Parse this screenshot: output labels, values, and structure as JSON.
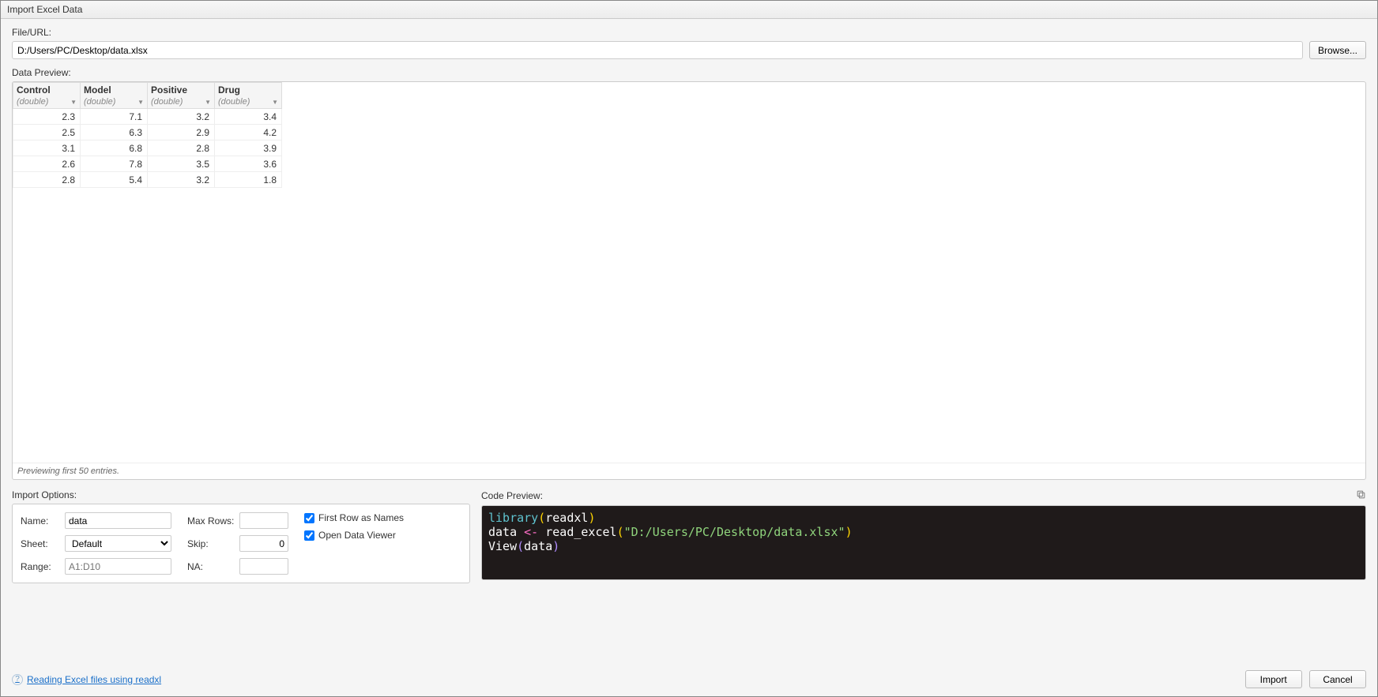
{
  "window_title": "Import Excel Data",
  "file_url_label": "File/URL:",
  "file_path": "D:/Users/PC/Desktop/data.xlsx",
  "browse_label": "Browse...",
  "data_preview_label": "Data Preview:",
  "columns": [
    {
      "name": "Control",
      "type": "(double)"
    },
    {
      "name": "Model",
      "type": "(double)"
    },
    {
      "name": "Positive",
      "type": "(double)"
    },
    {
      "name": "Drug",
      "type": "(double)"
    }
  ],
  "rows": [
    [
      "2.3",
      "7.1",
      "3.2",
      "3.4"
    ],
    [
      "2.5",
      "6.3",
      "2.9",
      "4.2"
    ],
    [
      "3.1",
      "6.8",
      "2.8",
      "3.9"
    ],
    [
      "2.6",
      "7.8",
      "3.5",
      "3.6"
    ],
    [
      "2.8",
      "5.4",
      "3.2",
      "1.8"
    ]
  ],
  "preview_status": "Previewing first 50 entries.",
  "import_options_label": "Import Options:",
  "options": {
    "name_label": "Name:",
    "name_value": "data",
    "sheet_label": "Sheet:",
    "sheet_value": "Default",
    "range_label": "Range:",
    "range_placeholder": "A1:D10",
    "maxrows_label": "Max Rows:",
    "maxrows_value": "",
    "skip_label": "Skip:",
    "skip_value": "0",
    "na_label": "NA:",
    "na_value": "",
    "first_row_label": "First Row as Names",
    "open_viewer_label": "Open Data Viewer"
  },
  "code_preview_label": "Code Preview:",
  "footeroptions": {
    "help_text": "Reading Excel files using readxl",
    "import_label": "Import",
    "cancel_label": "Cancel"
  }
}
